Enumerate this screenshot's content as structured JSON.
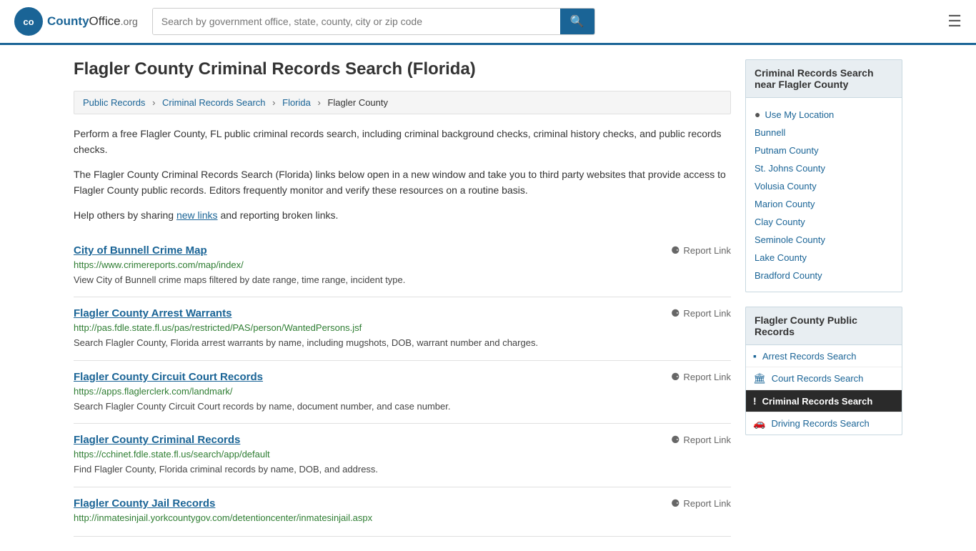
{
  "header": {
    "logo_text": "County",
    "logo_org": "Office",
    "logo_domain": ".org",
    "search_placeholder": "Search by government office, state, county, city or zip code",
    "search_value": ""
  },
  "page": {
    "title": "Flagler County Criminal Records Search (Florida)",
    "breadcrumb": [
      {
        "label": "Public Records",
        "href": "#"
      },
      {
        "label": "Criminal Records Search",
        "href": "#"
      },
      {
        "label": "Florida",
        "href": "#"
      },
      {
        "label": "Flagler County",
        "href": "#"
      }
    ],
    "description1": "Perform a free Flagler County, FL public criminal records search, including criminal background checks, criminal history checks, and public records checks.",
    "description2": "The Flagler County Criminal Records Search (Florida) links below open in a new window and take you to third party websites that provide access to Flagler County public records. Editors frequently monitor and verify these resources on a routine basis.",
    "help_text_before": "Help others by sharing ",
    "help_link_label": "new links",
    "help_text_after": " and reporting broken links."
  },
  "results": [
    {
      "title": "City of Bunnell Crime Map",
      "url": "https://www.crimereports.com/map/index/",
      "description": "View City of Bunnell crime maps filtered by date range, time range, incident type.",
      "report_label": "Report Link"
    },
    {
      "title": "Flagler County Arrest Warrants",
      "url": "http://pas.fdle.state.fl.us/pas/restricted/PAS/person/WantedPersons.jsf",
      "description": "Search Flagler County, Florida arrest warrants by name, including mugshots, DOB, warrant number and charges.",
      "report_label": "Report Link"
    },
    {
      "title": "Flagler County Circuit Court Records",
      "url": "https://apps.flaglerclerk.com/landmark/",
      "description": "Search Flagler County Circuit Court records by name, document number, and case number.",
      "report_label": "Report Link"
    },
    {
      "title": "Flagler County Criminal Records",
      "url": "https://cchinet.fdle.state.fl.us/search/app/default",
      "description": "Find Flagler County, Florida criminal records by name, DOB, and address.",
      "report_label": "Report Link"
    },
    {
      "title": "Flagler County Jail Records",
      "url": "http://inmatesinjail.yorkcountygov.com/detentioncenter/inmatesinjail.aspx",
      "description": "",
      "report_label": "Report Link"
    }
  ],
  "sidebar": {
    "nearby_heading": "Criminal Records Search near Flagler County",
    "use_my_location": "Use My Location",
    "nearby_links": [
      {
        "label": "Bunnell"
      },
      {
        "label": "Putnam County"
      },
      {
        "label": "St. Johns County"
      },
      {
        "label": "Volusia County"
      },
      {
        "label": "Marion County"
      },
      {
        "label": "Clay County"
      },
      {
        "label": "Seminole County"
      },
      {
        "label": "Lake County"
      },
      {
        "label": "Bradford County"
      }
    ],
    "records_heading": "Flagler County Public Records",
    "records_links": [
      {
        "label": "Arrest Records Search",
        "icon": "▪",
        "active": false
      },
      {
        "label": "Court Records Search",
        "icon": "🏛",
        "active": false
      },
      {
        "label": "Criminal Records Search",
        "icon": "!",
        "active": true
      },
      {
        "label": "Driving Records Search",
        "icon": "🚗",
        "active": false
      }
    ]
  }
}
